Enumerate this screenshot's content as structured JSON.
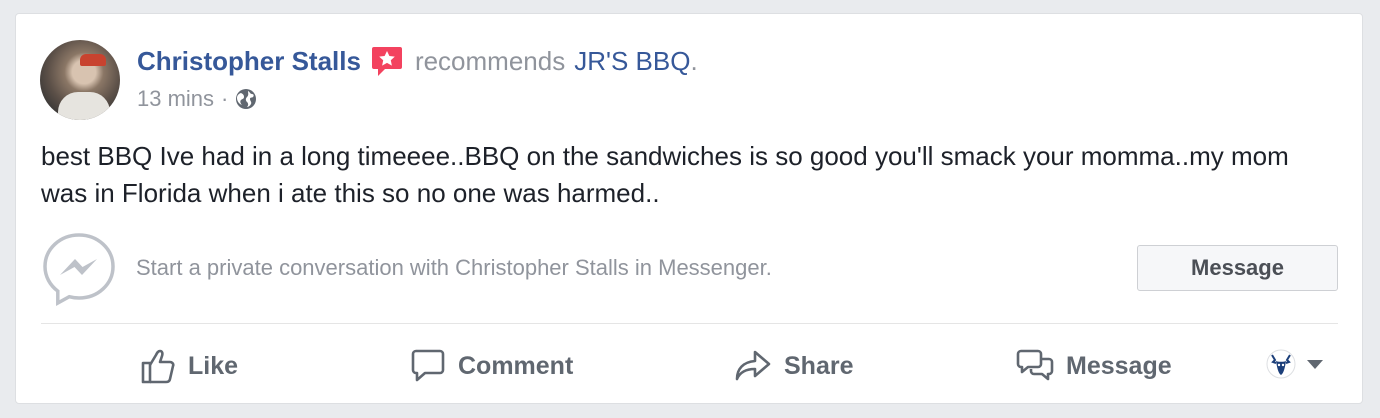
{
  "post": {
    "author": "Christopher Stalls",
    "recommend_text": "recommends",
    "page_name": "JR'S BBQ",
    "period": ".",
    "time": "13 mins",
    "separator": "·",
    "privacy_icon": "globe-icon",
    "body": "best BBQ Ive had in a long timeeee..BBQ on the sandwiches is so good you'll smack your momma..my mom was in Florida when i ate this so no one was harmed.."
  },
  "messenger_prompt": {
    "icon": "messenger-icon",
    "text": "Start a private conversation with Christopher Stalls in Messenger.",
    "button_label": "Message"
  },
  "actions": [
    {
      "label": "Like",
      "icon": "thumbs-up-icon"
    },
    {
      "label": "Comment",
      "icon": "comment-icon"
    },
    {
      "label": "Share",
      "icon": "share-icon"
    },
    {
      "label": "Message",
      "icon": "message-bubbles-icon"
    }
  ],
  "page_selector": {
    "icon": "page-avatar-icon",
    "caret": "caret-down-icon"
  },
  "colors": {
    "link": "#365899",
    "recommend_badge": "#f3425f",
    "muted": "#90949c",
    "body_text": "#1d2129",
    "background": "#e9ebee"
  }
}
